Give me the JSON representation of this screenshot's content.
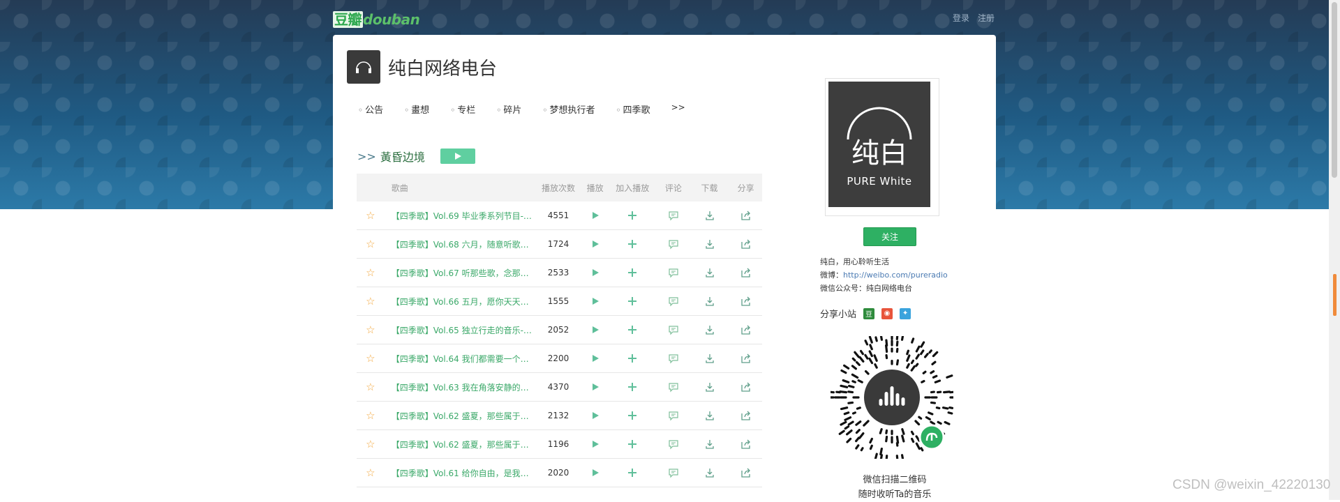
{
  "header": {
    "logo_cn": "豆瓣",
    "logo_en": "douban",
    "login": "登录",
    "register": "注册"
  },
  "station": {
    "title": "纯白网络电台",
    "tabs": [
      "公告",
      "畫想",
      "专栏",
      "碎片",
      "梦想执行者",
      "四季歌"
    ],
    "more": ">>"
  },
  "album": {
    "arrow": ">>",
    "name": "黃昏边境"
  },
  "table": {
    "headers": {
      "song": "歌曲",
      "plays": "播放次数",
      "play": "播放",
      "add": "加入播放",
      "comment": "评论",
      "download": "下载",
      "share": "分享"
    },
    "rows": [
      {
        "name": "【四季歌】Vol.69 毕业季系列节目--…",
        "plays": "4551"
      },
      {
        "name": "【四季歌】Vol.68 六月，随意听歌吧 …",
        "plays": "1724"
      },
      {
        "name": "【四季歌】Vol.67 听那些歌，念那些…",
        "plays": "2533"
      },
      {
        "name": "【四季歌】Vol.66 五月，愿你天天晴…",
        "plays": "1555"
      },
      {
        "name": "【四季歌】Vol.65 独立行走的音乐--…",
        "plays": "2052"
      },
      {
        "name": "【四季歌】Vol.64 我们都需要一个爱…",
        "plays": "2200"
      },
      {
        "name": "【四季歌】Vol.63 我在角落安静的唱…",
        "plays": "4370"
      },
      {
        "name": "【四季歌】Vol.62 盛夏，那些属于我…",
        "plays": "2132"
      },
      {
        "name": "【四季歌】Vol.62 盛夏，那些属于我…",
        "plays": "1196"
      },
      {
        "name": "【四季歌】Vol.61 给你自由，是我最…",
        "plays": "2020"
      }
    ]
  },
  "sidebar": {
    "cover_cn": "纯白",
    "cover_en": "PURE White",
    "follow": "关注",
    "desc_line1": "纯白，用心聆听生活",
    "weibo_label": "微博：",
    "weibo_link": "http://weibo.com/pureradio",
    "wechat_label": "微信公众号：纯白网络电台",
    "share_label": "分享小站",
    "qr_caption_1": "微信扫描二维码",
    "qr_caption_2": "随时收听Ta的音乐"
  },
  "watermark": "CSDN @weixin_42220130",
  "colors": {
    "accent_green": "#2eb063",
    "song_link": "#3aa868",
    "star": "#f3a73c",
    "play_button": "#5fcfa0"
  }
}
